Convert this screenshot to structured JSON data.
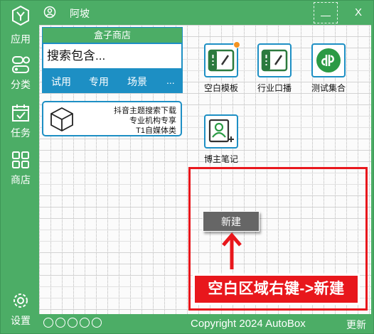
{
  "header": {
    "user_name": "阿坡",
    "close_label": "X"
  },
  "nav": {
    "apps_label": "应用",
    "categories_label": "分类",
    "tasks_label": "任务",
    "store_label": "商店",
    "settings_label": "设置"
  },
  "store": {
    "title": "盒子商店",
    "search_placeholder": "搜索包含...",
    "tabs": [
      "试用",
      "专用",
      "场景",
      "..."
    ],
    "card": {
      "lines": [
        "抖音主题搜索下载",
        "专业机构专享",
        "T1自媒体类"
      ]
    }
  },
  "apps": [
    {
      "label": "空白模板",
      "icon": "blank-template-icon",
      "has_badge": true
    },
    {
      "label": "行业口播",
      "icon": "industry-broadcast-icon",
      "has_badge": false
    },
    {
      "label": "测试集合",
      "icon": "test-collection-icon",
      "has_badge": false
    },
    {
      "label": "博主笔记",
      "icon": "blogger-notes-icon",
      "has_badge": false
    }
  ],
  "context_menu": {
    "new_label": "新建"
  },
  "annotation": {
    "hint": "空白区域右键->新建"
  },
  "footer": {
    "page_dots": 5,
    "copyright": "Copyright  2024   AutoBox",
    "update_label": "更新"
  },
  "colors": {
    "primary_green": "#4cad66",
    "accent_blue": "#1d8fc4",
    "highlight_red": "#e8171c",
    "badge_orange": "#f39321"
  }
}
